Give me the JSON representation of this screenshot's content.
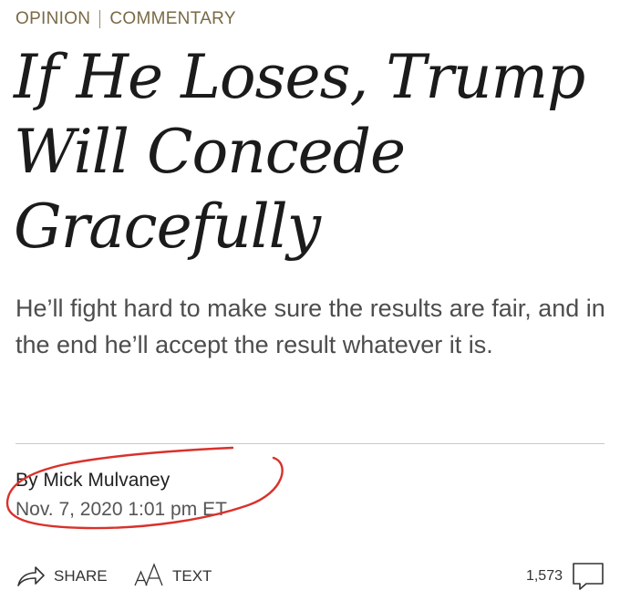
{
  "section": {
    "primary": "OPINION",
    "secondary": "COMMENTARY"
  },
  "article": {
    "headline": "If He Loses, Trump Will Concede Gracefully",
    "dek": "He’ll fight hard to make sure the results are fair, and in the end he’ll accept the result whatever it is.",
    "byline_prefix": "By",
    "author": "Mick Mulvaney",
    "timestamp": "Nov. 7, 2020 1:01 pm ET"
  },
  "toolbar": {
    "share_label": "SHARE",
    "text_label": "TEXT",
    "comment_count": "1,573"
  },
  "icons": {
    "share": "share-arrow-icon",
    "text_size": "text-size-icon",
    "comments": "speech-bubble-icon"
  },
  "colors": {
    "section_label": "#7a6a45",
    "annotation_ink": "#d9312b",
    "dek_text": "#4d4d4d"
  }
}
